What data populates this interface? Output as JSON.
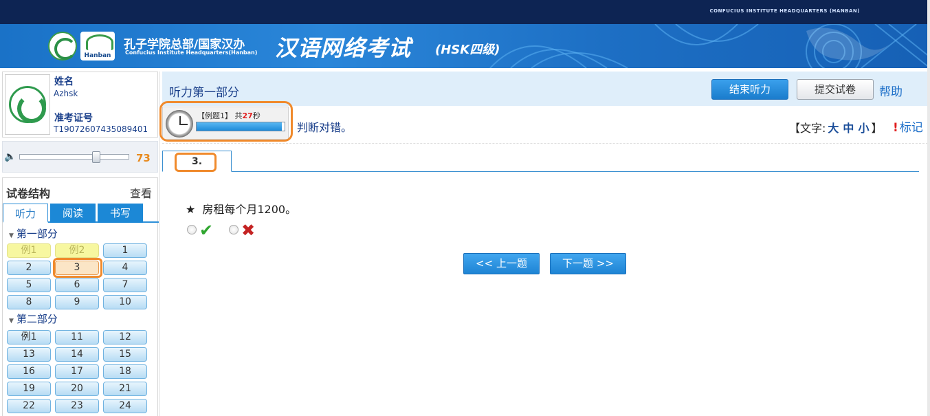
{
  "header": {
    "top_text": "CONFUCIUS INSTITUTE HEADQUARTERS (HANBAN)",
    "hanban_logo_text": "Hanban",
    "cih_chinese": "孔子学院总部/国家汉办",
    "cih_english": "Confucius Institute Headquarters(Hanban)",
    "exam_title": "汉语网络考试",
    "exam_level": "(HSK四级)",
    "colors": {
      "topbar": "#0d2453",
      "banner": "#2a86d9"
    }
  },
  "candidate": {
    "name_label": "姓名",
    "name_value": "Azhsk",
    "id_label": "准考证号",
    "id_value": "T19072607435089401"
  },
  "volume": {
    "icon": "speaker-icon",
    "value": "73",
    "level_fraction": 0.73
  },
  "structure": {
    "title": "试卷结构",
    "view": "查看",
    "tabs": [
      {
        "label": "听力",
        "active": true
      },
      {
        "label": "阅读",
        "active": false
      },
      {
        "label": "书写",
        "active": false
      }
    ],
    "parts": [
      {
        "label": "第一部分",
        "questions": [
          "例1",
          "例2",
          "1",
          "2",
          "3",
          "4",
          "5",
          "6",
          "7",
          "8",
          "9",
          "10"
        ]
      },
      {
        "label": "第二部分",
        "questions": [
          "例1",
          "11",
          "12",
          "13",
          "14",
          "15",
          "16",
          "17",
          "18",
          "19",
          "20",
          "21",
          "22",
          "23",
          "24"
        ]
      }
    ],
    "current_question": "3"
  },
  "section": {
    "title": "听力第一部分",
    "end_listening": "结束听力",
    "submit": "提交试卷",
    "help": "帮助"
  },
  "timer": {
    "label_prefix": "【例题1】 共",
    "seconds": "27",
    "label_suffix": "秒",
    "progress_fraction": 0.97
  },
  "instruction": "判断对错。",
  "font_size": {
    "prefix": "【文字:",
    "large": "大",
    "medium": "中",
    "small": "小",
    "suffix": "】",
    "mark": "标记"
  },
  "question": {
    "tab_label": "3.",
    "star": "★",
    "text": "房租每个月1200。",
    "options": [
      "check-icon",
      "cross-icon"
    ]
  },
  "navigation": {
    "prev": "<< 上一题",
    "next": "下一题 >>"
  }
}
